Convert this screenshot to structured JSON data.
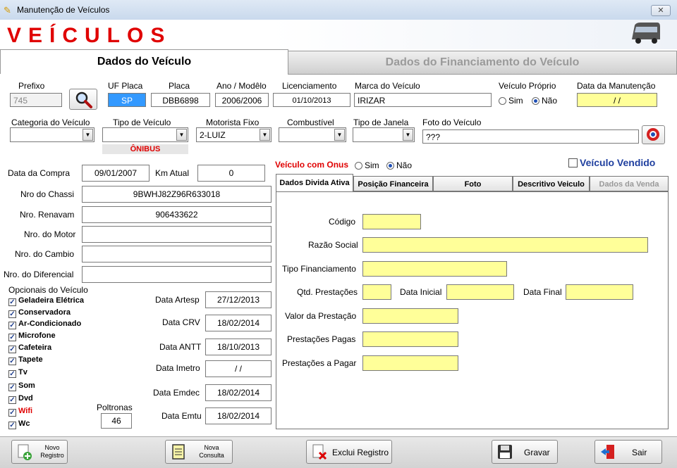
{
  "window": {
    "title": "Manutenção de Veículos",
    "close": "✕"
  },
  "header": {
    "title": "VEÍCULOS"
  },
  "tabs": {
    "main": "Dados do Veículo",
    "financing": "Dados do Financiamento do Veículo"
  },
  "top_fields": {
    "prefixo_label": "Prefixo",
    "prefixo": "745",
    "uf_label": "UF Placa",
    "uf": "SP",
    "placa_label": "Placa",
    "placa": "DBB6898",
    "ano_label": "Ano / Modêlo",
    "ano": "2006/2006",
    "lic_label": "Licenciamento",
    "lic": "01/10/2013",
    "marca_label": "Marca do Veículo",
    "marca": "IRIZAR",
    "proprio_label": "Veículo Próprio",
    "sim": "Sim",
    "nao": "Não",
    "manut_label": "Data da Manutenção",
    "manut": " / /"
  },
  "combos": {
    "categoria_label": "Categoria do Veículo",
    "categoria": "",
    "tipo_label": "Tipo de Veículo",
    "tipo": "",
    "tipo_badge": "ÔNIBUS",
    "motorista_label": "Motorista Fixo",
    "motorista": "2-LUIZ",
    "comb_label": "Combustível",
    "comb": "",
    "janela_label": "Tipo de Janela",
    "janela": "",
    "foto_label": "Foto do Veículo",
    "foto": "???"
  },
  "details": {
    "compra_label": "Data da Compra",
    "compra": "09/01/2007",
    "km_label": "Km Atual",
    "km": "0",
    "chassi_label": "Nro do Chassi",
    "chassi": "9BWHJ82Z96R633018",
    "renavam_label": "Nro. Renavam",
    "renavam": "906433622",
    "motor_label": "Nro. do Motor",
    "motor": "",
    "cambio_label": "Nro. do Cambio",
    "cambio": "",
    "diferencial_label": "Nro. do Diferencial",
    "diferencial": ""
  },
  "opcionais": {
    "label": "Opcionais do Veículo",
    "items": [
      "Geladeira Elétrica",
      "Conservadora",
      "Ar-Condicionado",
      "Microfone",
      "Cafeteira",
      "Tapete",
      "Tv",
      "Som",
      "Dvd",
      "Wifi",
      "Wc"
    ],
    "poltronas_label": "Poltronas",
    "poltronas": "46"
  },
  "datas": {
    "artesp_label": "Data Artesp",
    "artesp": "27/12/2013",
    "crv_label": "Data CRV",
    "crv": "18/02/2014",
    "antt_label": "Data ANTT",
    "antt": "18/10/2013",
    "imetro_label": "Data Imetro",
    "imetro": " / /",
    "emdec_label": "Data Emdec",
    "emdec": "18/02/2014",
    "emtu_label": "Data Emtu",
    "emtu": "18/02/2014"
  },
  "onus": {
    "label": "Veículo com Onus",
    "sim": "Sim",
    "nao": "Não",
    "vendido": "Veículo Vendido"
  },
  "subtabs": [
    "Dados Divida Ativa",
    "Posição Financeira",
    "Foto",
    "Descritivo Veiculo",
    "Dados da Venda"
  ],
  "divida": {
    "codigo": "Código",
    "razao": "Razão Social",
    "tipo_fin": "Tipo Financiamento",
    "qtd": "Qtd. Prestações",
    "data_ini": "Data Inicial",
    "data_fim": "Data Final",
    "valor": "Valor da Prestação",
    "pagas": "Prestações Pagas",
    "apagar": "Prestações a Pagar"
  },
  "footer": {
    "novo_l1": "Novo",
    "novo_l2": "Registro",
    "consulta_l1": "Nova",
    "consulta_l2": "Consulta",
    "exclui": "Exclui Registro",
    "gravar": "Gravar",
    "sair": "Sair"
  },
  "colors": {
    "title_red": "#e00000",
    "field_yellow": "#ffff99",
    "accent_blue": "#1f3f8f"
  }
}
